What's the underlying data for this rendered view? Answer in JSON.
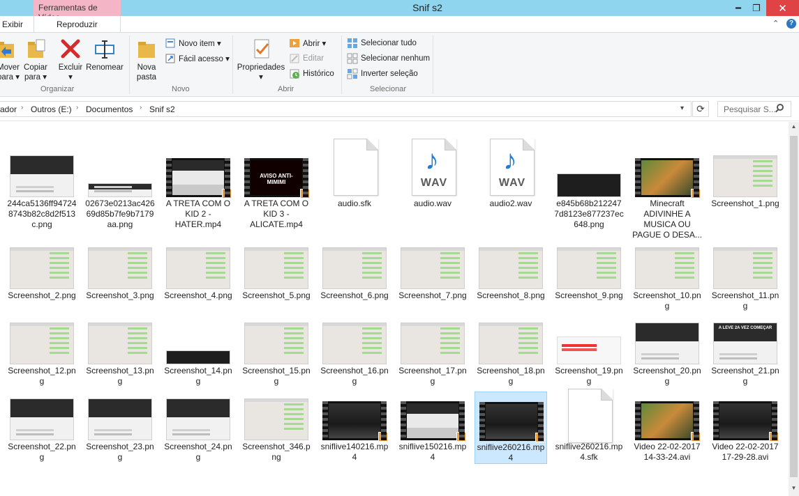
{
  "window": {
    "title": "Snif s2",
    "context_tab": "Ferramentas de Vídeo",
    "tabs": [
      "Exibir",
      "Reproduzir"
    ],
    "min_glyph": "━",
    "max_glyph": "❐",
    "close_glyph": "✕",
    "help_chevron": "⌃",
    "help_glyph": "?"
  },
  "ribbon": {
    "organizar": {
      "label": "Organizar",
      "mover": "Mover\npara ▾",
      "copiar": "Copiar\npara ▾",
      "excluir": "Excluir\n▾",
      "renomear": "Renomear"
    },
    "novo": {
      "label": "Novo",
      "nova_pasta": "Nova\npasta",
      "novo_item": "Novo item ▾",
      "facil_acesso": "Fácil acesso ▾"
    },
    "abrir": {
      "label": "Abrir",
      "propriedades": "Propriedades\n▾",
      "abrir": "Abrir ▾",
      "editar": "Editar",
      "historico": "Histórico"
    },
    "selecionar": {
      "label": "Selecionar",
      "tudo": "Selecionar tudo",
      "nenhum": "Selecionar nenhum",
      "inverter": "Inverter seleção"
    }
  },
  "address": {
    "crumbs": [
      "ador",
      "Outros (E:)",
      "Documentos",
      "Snif s2"
    ],
    "search_placeholder": "Pesquisar S..."
  },
  "files": [
    {
      "name": "244ca5136ff947248743b82c8d2f513c.png",
      "kind": "web"
    },
    {
      "name": "02673e0213ac42669d85b7fe9b7179aa.png",
      "kind": "wide"
    },
    {
      "name": "A TRETA COM O KID 2 - HATER.mp4",
      "kind": "video-web"
    },
    {
      "name": "A TRETA COM O KID 3 - ALICATE.mp4",
      "kind": "video-red",
      "overlay": "AVISO ANTI-MIMIMI"
    },
    {
      "name": "audio.sfk",
      "kind": "doc"
    },
    {
      "name": "audio.wav",
      "kind": "wav",
      "badge": "WAV"
    },
    {
      "name": "audio2.wav",
      "kind": "wav",
      "badge": "WAV"
    },
    {
      "name": "e845b68b2122477d8123e877237ec648.png",
      "kind": "dark-wide"
    },
    {
      "name": "Minecraft ADIVINHE A MUSICA OU PAGUE O DESA...",
      "kind": "video-game"
    },
    {
      "name": "Screenshot_1.png",
      "kind": "ss"
    },
    {
      "name": "Screenshot_2.png",
      "kind": "ss"
    },
    {
      "name": "Screenshot_3.png",
      "kind": "ss"
    },
    {
      "name": "Screenshot_4.png",
      "kind": "ss"
    },
    {
      "name": "Screenshot_5.png",
      "kind": "ss"
    },
    {
      "name": "Screenshot_6.png",
      "kind": "ss"
    },
    {
      "name": "Screenshot_7.png",
      "kind": "ss"
    },
    {
      "name": "Screenshot_8.png",
      "kind": "ss"
    },
    {
      "name": "Screenshot_9.png",
      "kind": "ss"
    },
    {
      "name": "Screenshot_10.png",
      "kind": "ss"
    },
    {
      "name": "Screenshot_11.png",
      "kind": "ss"
    },
    {
      "name": "Screenshot_12.png",
      "kind": "ss"
    },
    {
      "name": "Screenshot_13.png",
      "kind": "ss"
    },
    {
      "name": "Screenshot_14.png",
      "kind": "dark-strip"
    },
    {
      "name": "Screenshot_15.png",
      "kind": "ss"
    },
    {
      "name": "Screenshot_16.png",
      "kind": "ss"
    },
    {
      "name": "Screenshot_17.png",
      "kind": "ss"
    },
    {
      "name": "Screenshot_18.png",
      "kind": "ss"
    },
    {
      "name": "Screenshot_19.png",
      "kind": "red-wide"
    },
    {
      "name": "Screenshot_20.png",
      "kind": "web"
    },
    {
      "name": "Screenshot_21.png",
      "kind": "web",
      "overlay": "A LEVE 2A VEZ COMEÇAR"
    },
    {
      "name": "Screenshot_22.png",
      "kind": "web"
    },
    {
      "name": "Screenshot_23.png",
      "kind": "web"
    },
    {
      "name": "Screenshot_24.png",
      "kind": "web"
    },
    {
      "name": "Screenshot_346.png",
      "kind": "ss"
    },
    {
      "name": "sniflive140216.mp4",
      "kind": "video-dark"
    },
    {
      "name": "sniflive150216.mp4",
      "kind": "video-web"
    },
    {
      "name": "sniflive260216.mp4",
      "kind": "video-dark",
      "selected": true
    },
    {
      "name": "sniflive260216.mp4.sfk",
      "kind": "doc"
    },
    {
      "name": "Video 22-02-2017 14-33-24.avi",
      "kind": "video-game"
    },
    {
      "name": "Video 22-02-2017 17-29-28.avi",
      "kind": "video-dark"
    }
  ],
  "scrollbar": {
    "up": "▲",
    "down": "▼"
  },
  "colors": {
    "titlebar": "#8fd5ed",
    "context_tab": "#f4b6c6",
    "close": "#e04343",
    "selection": "#cce8ff"
  }
}
